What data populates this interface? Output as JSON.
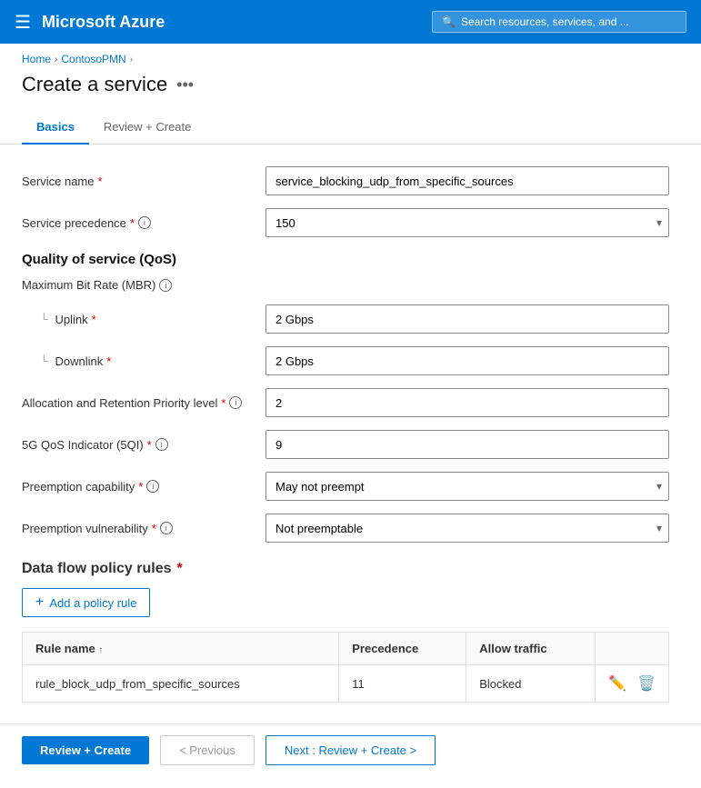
{
  "topbar": {
    "menu_icon": "☰",
    "title": "Microsoft Azure",
    "search_placeholder": "Search resources, services, and ..."
  },
  "breadcrumb": {
    "home": "Home",
    "parent": "ContosoPMN",
    "sep": "›"
  },
  "page": {
    "title": "Create a service",
    "menu_icon": "•••"
  },
  "tabs": [
    {
      "label": "Basics",
      "active": true
    },
    {
      "label": "Review + Create",
      "active": false
    }
  ],
  "form": {
    "service_name_label": "Service name",
    "service_name_value": "service_blocking_udp_from_specific_sources",
    "service_precedence_label": "Service precedence",
    "service_precedence_info": "i",
    "service_precedence_value": "150",
    "qos_section": "Quality of service (QoS)",
    "mbr_label": "Maximum Bit Rate (MBR)",
    "mbr_info": "i",
    "uplink_label": "Uplink",
    "uplink_value": "2 Gbps",
    "downlink_label": "Downlink",
    "downlink_value": "2 Gbps",
    "arp_label": "Allocation and Retention Priority level",
    "arp_info": "i",
    "arp_value": "2",
    "qos_indicator_label": "5G QoS Indicator (5QI)",
    "qos_indicator_info": "i",
    "qos_indicator_value": "9",
    "preemption_cap_label": "Preemption capability",
    "preemption_cap_info": "i",
    "preemption_cap_value": "May not preempt",
    "preemption_vuln_label": "Preemption vulnerability",
    "preemption_vuln_info": "i",
    "preemption_vuln_value": "Not preemptable"
  },
  "policy_rules": {
    "section_label": "Data flow policy rules",
    "required_star": "*",
    "add_button": "Add a policy rule",
    "table": {
      "columns": [
        "Rule name",
        "Precedence",
        "Allow traffic",
        ""
      ],
      "rows": [
        {
          "rule_name": "rule_block_udp_from_specific_sources",
          "precedence": "11",
          "allow_traffic": "Blocked"
        }
      ]
    }
  },
  "footer": {
    "review_create": "Review + Create",
    "previous": "< Previous",
    "next": "Next : Review + Create >"
  }
}
